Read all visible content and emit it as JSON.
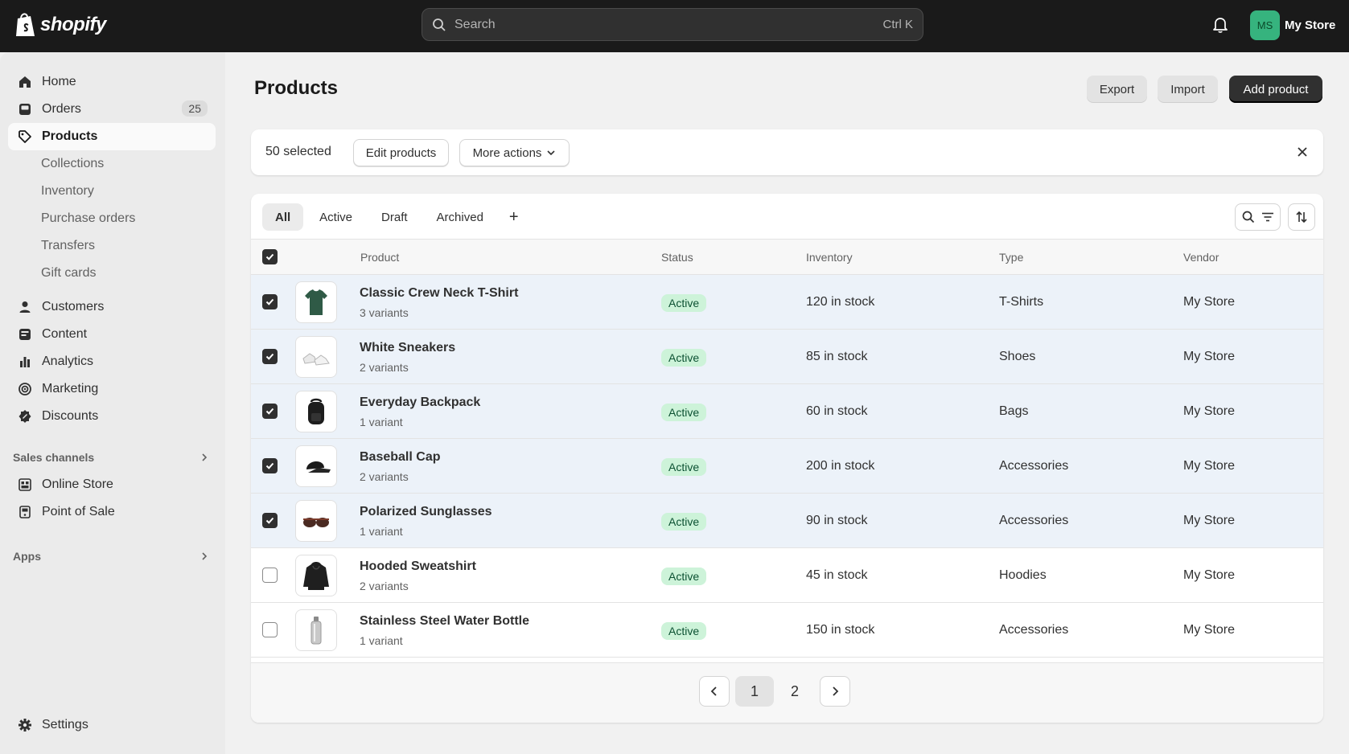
{
  "topbar": {
    "brand": "shopify",
    "search_placeholder": "Search",
    "search_shortcut": "Ctrl K",
    "avatar_initials": "MS",
    "store_name": "My Store"
  },
  "sidebar": {
    "home": "Home",
    "orders": "Orders",
    "orders_count": "25",
    "products": "Products",
    "collections": "Collections",
    "inventory": "Inventory",
    "purchase_orders": "Purchase orders",
    "transfers": "Transfers",
    "gift_cards": "Gift cards",
    "customers": "Customers",
    "content": "Content",
    "analytics": "Analytics",
    "marketing": "Marketing",
    "discounts": "Discounts",
    "sales_channels": "Sales channels",
    "online_store": "Online Store",
    "point_of_sale": "Point of Sale",
    "apps": "Apps",
    "settings": "Settings"
  },
  "page": {
    "title": "Products",
    "export": "Export",
    "import": "Import",
    "add_product": "Add product"
  },
  "bulk": {
    "selected": "50 selected",
    "edit": "Edit products",
    "more": "More actions"
  },
  "tabs": [
    "All",
    "Active",
    "Draft",
    "Archived",
    "+"
  ],
  "columns": {
    "product": "Product",
    "status": "Status",
    "inventory": "Inventory",
    "type": "Type",
    "vendor": "Vendor"
  },
  "products": [
    {
      "name": "Classic Crew Neck T-Shirt",
      "variants": "3 variants",
      "status": "Active",
      "inventory": "120 in stock",
      "type": "T-Shirts",
      "vendor": "My Store",
      "selected": true,
      "icon": "tshirt-icon"
    },
    {
      "name": "White Sneakers",
      "variants": "2 variants",
      "status": "Active",
      "inventory": "85 in stock",
      "type": "Shoes",
      "vendor": "My Store",
      "selected": true,
      "icon": "sneakers-icon"
    },
    {
      "name": "Everyday Backpack",
      "variants": "1 variant",
      "status": "Active",
      "inventory": "60 in stock",
      "type": "Bags",
      "vendor": "My Store",
      "selected": true,
      "icon": "backpack-icon"
    },
    {
      "name": "Baseball Cap",
      "variants": "2 variants",
      "status": "Active",
      "inventory": "200 in stock",
      "type": "Accessories",
      "vendor": "My Store",
      "selected": true,
      "icon": "cap-icon"
    },
    {
      "name": "Polarized Sunglasses",
      "variants": "1 variant",
      "status": "Active",
      "inventory": "90 in stock",
      "type": "Accessories",
      "vendor": "My Store",
      "selected": true,
      "icon": "sunglasses-icon"
    },
    {
      "name": "Hooded Sweatshirt",
      "variants": "2 variants",
      "status": "Active",
      "inventory": "45 in stock",
      "type": "Hoodies",
      "vendor": "My Store",
      "selected": false,
      "icon": "hoodie-icon"
    },
    {
      "name": "Stainless Steel Water Bottle",
      "variants": "1 variant",
      "status": "Active",
      "inventory": "150 in stock",
      "type": "Accessories",
      "vendor": "My Store",
      "selected": false,
      "icon": "bottle-icon"
    }
  ],
  "pagination": {
    "current": "1",
    "next": "2"
  },
  "colors": {
    "topbar": "#1a1a1a",
    "active_badge": "#cdf3d9",
    "selected_row": "#ecf2f9",
    "avatar": "#36b37e"
  }
}
